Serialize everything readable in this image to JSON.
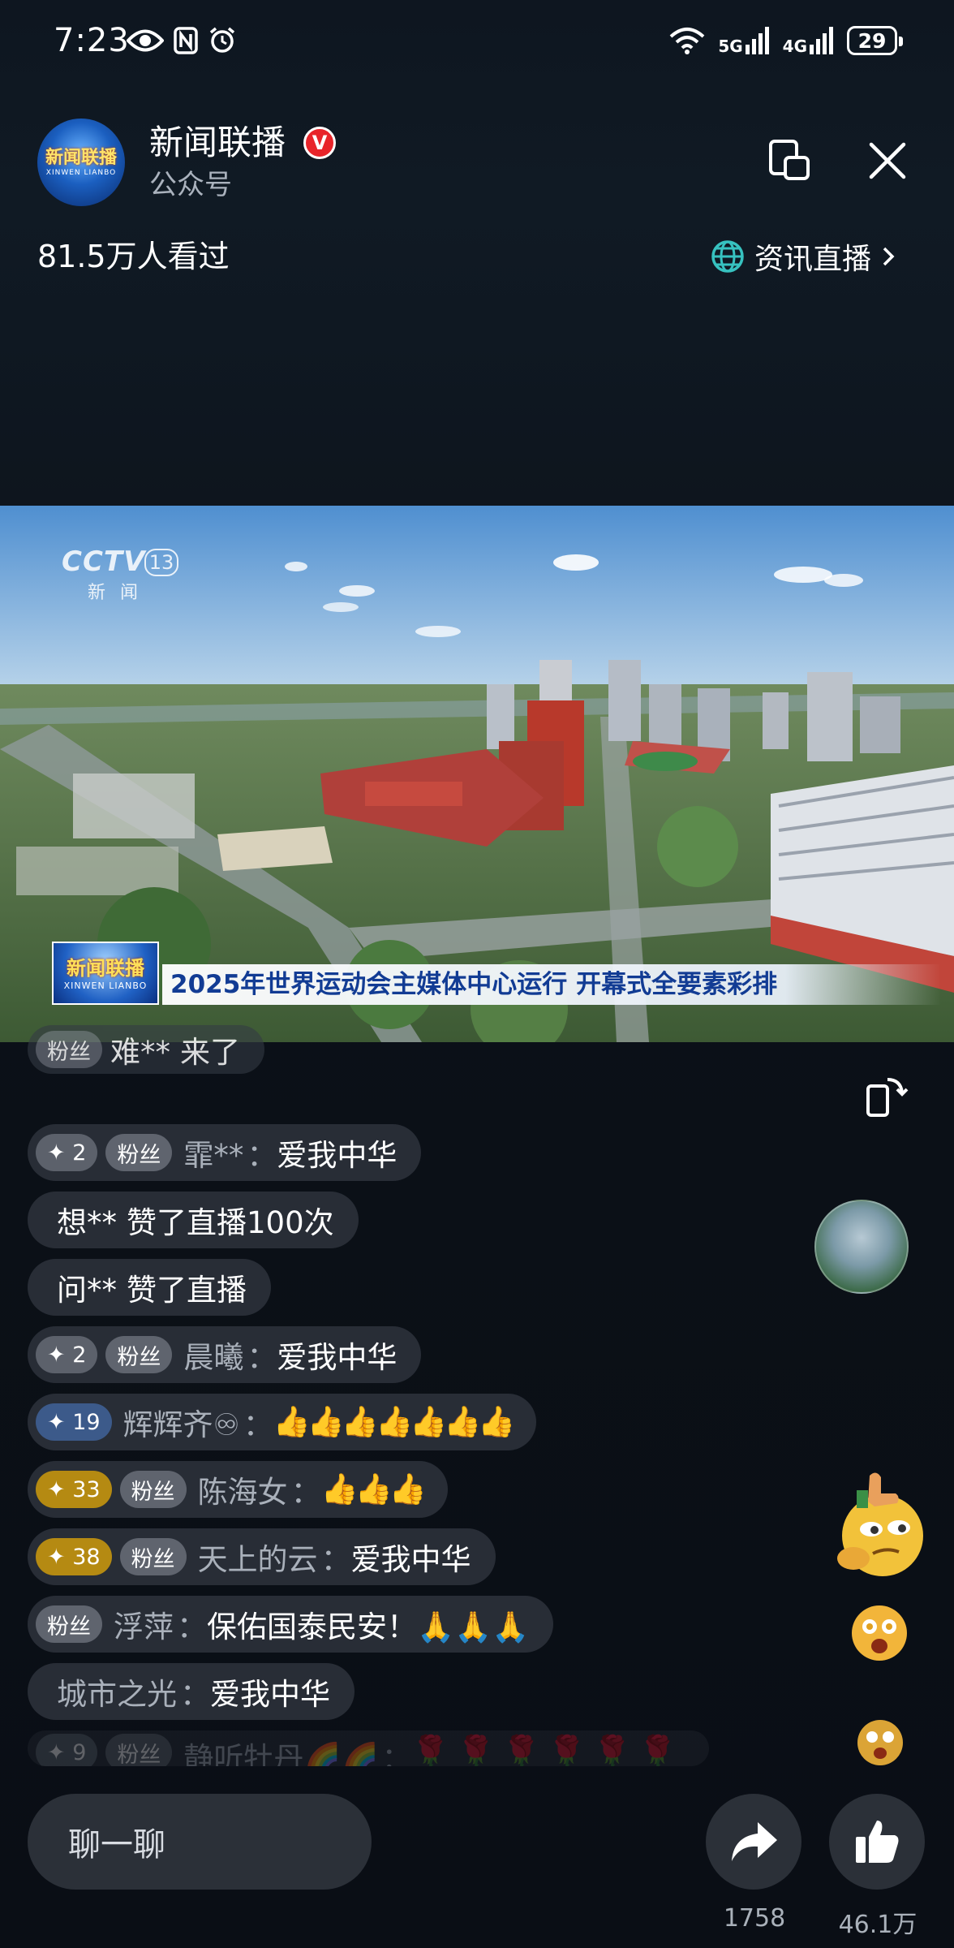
{
  "status_bar": {
    "time": "7:23",
    "network_5g": "5G",
    "network_4g": "4G",
    "battery": "29"
  },
  "header": {
    "avatar_logo": "新闻联播",
    "avatar_logo_en": "XINWEN LIANBO",
    "channel_name": "新闻联播",
    "verified_mark": "V",
    "channel_type": "公众号",
    "viewers": "81.5万人看过",
    "category": "资讯直播"
  },
  "video": {
    "watermark": "CCTV",
    "watermark_channel": "13",
    "watermark_sub": "新闻",
    "program_badge": "新闻联播",
    "program_badge_en": "XINWEN LIANBO",
    "headline": "2025年世界运动会主媒体中心运行 开幕式全要素彩排"
  },
  "comments": [
    {
      "badges": [
        "粉丝"
      ],
      "user": "难**",
      "text": "来了"
    },
    {
      "badges": [
        "✦ 2",
        "粉丝"
      ],
      "user": "霏**",
      "text": "爱我中华"
    },
    {
      "badges": [],
      "user": "想**",
      "text": "赞了直播100次"
    },
    {
      "badges": [],
      "user": "问**",
      "text": "赞了直播"
    },
    {
      "badges": [
        "✦ 2",
        "粉丝"
      ],
      "user": "晨曦",
      "text": "爱我中华"
    },
    {
      "badges": [
        "✦ 19"
      ],
      "user": "辉辉齐♾",
      "text": "👍👍👍👍👍👍👍"
    },
    {
      "badges": [
        "✦ 33",
        "粉丝"
      ],
      "user": "陈海女",
      "text": "👍👍👍"
    },
    {
      "badges": [
        "✦ 38",
        "粉丝"
      ],
      "user": "天上的云",
      "text": "爱我中华"
    },
    {
      "badges": [
        "粉丝"
      ],
      "user": "浮萍",
      "text": "保佑国泰民安！🙏🙏🙏"
    },
    {
      "badges": [],
      "user": "城市之光",
      "text": "爱我中华"
    },
    {
      "badges": [
        "✦ 9",
        "粉丝"
      ],
      "user": "静听牡丹🌈🌈",
      "text": "🌹🌹🌹🌹🌹🌹"
    }
  ],
  "bottom_bar": {
    "chat_placeholder": "聊一聊",
    "share_count": "1758",
    "like_count": "46.1万"
  },
  "colors": {
    "background": "#0c1219",
    "headline_text": "#123c94",
    "verified": "#e8242a",
    "gold_badge": "#b58a12",
    "blue_badge": "#3c5a8a"
  }
}
